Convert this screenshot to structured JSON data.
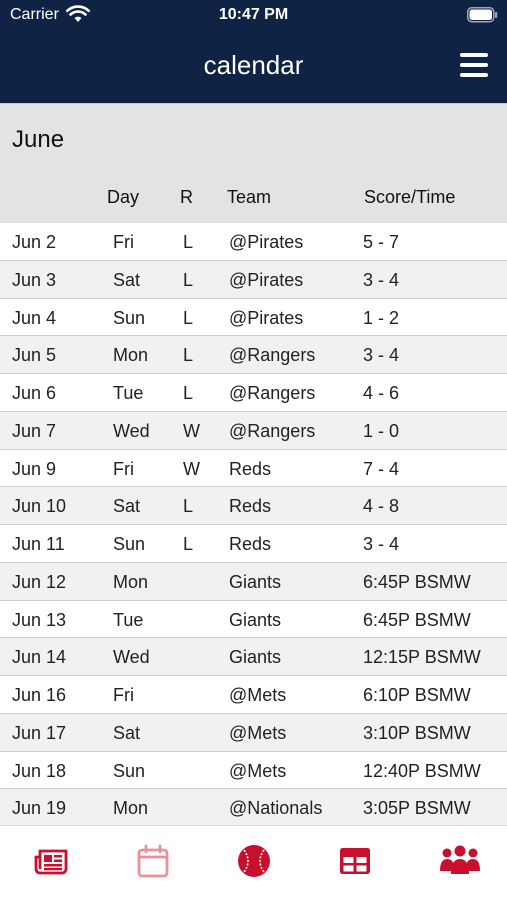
{
  "status": {
    "carrier": "Carrier",
    "time": "10:47 PM"
  },
  "header": {
    "title": "calendar",
    "menu_icon": "hamburger-menu-icon"
  },
  "month": "June",
  "columns": {
    "date": "",
    "day": "Day",
    "result": "R",
    "team": "Team",
    "score": "Score/Time"
  },
  "games": [
    {
      "date": "Jun 2",
      "day": "Fri",
      "result": "L",
      "team": "@Pirates",
      "score": "5 - 7"
    },
    {
      "date": "Jun 3",
      "day": "Sat",
      "result": "L",
      "team": "@Pirates",
      "score": "3 - 4"
    },
    {
      "date": "Jun 4",
      "day": "Sun",
      "result": "L",
      "team": "@Pirates",
      "score": "1 - 2"
    },
    {
      "date": "Jun 5",
      "day": "Mon",
      "result": "L",
      "team": "@Rangers",
      "score": "3 - 4"
    },
    {
      "date": "Jun 6",
      "day": "Tue",
      "result": "L",
      "team": "@Rangers",
      "score": "4 - 6"
    },
    {
      "date": "Jun 7",
      "day": "Wed",
      "result": "W",
      "team": "@Rangers",
      "score": "1 - 0"
    },
    {
      "date": "Jun 9",
      "day": "Fri",
      "result": "W",
      "team": "Reds",
      "score": "7 - 4"
    },
    {
      "date": "Jun 10",
      "day": "Sat",
      "result": "L",
      "team": "Reds",
      "score": "4 - 8"
    },
    {
      "date": "Jun 11",
      "day": "Sun",
      "result": "L",
      "team": "Reds",
      "score": "3 - 4"
    },
    {
      "date": "Jun 12",
      "day": "Mon",
      "result": "",
      "team": "Giants",
      "score": "6:45P BSMW"
    },
    {
      "date": "Jun 13",
      "day": "Tue",
      "result": "",
      "team": "Giants",
      "score": "6:45P BSMW"
    },
    {
      "date": "Jun 14",
      "day": "Wed",
      "result": "",
      "team": "Giants",
      "score": "12:15P BSMW"
    },
    {
      "date": "Jun 16",
      "day": "Fri",
      "result": "",
      "team": "@Mets",
      "score": "6:10P BSMW"
    },
    {
      "date": "Jun 17",
      "day": "Sat",
      "result": "",
      "team": "@Mets",
      "score": "3:10P BSMW"
    },
    {
      "date": "Jun 18",
      "day": "Sun",
      "result": "",
      "team": "@Mets",
      "score": "12:40P BSMW"
    },
    {
      "date": "Jun 19",
      "day": "Mon",
      "result": "",
      "team": "@Nationals",
      "score": "3:05P BSMW"
    }
  ],
  "tabs": [
    {
      "name": "news",
      "icon": "newspaper-icon",
      "active": false
    },
    {
      "name": "calendar",
      "icon": "calendar-icon",
      "active": true
    },
    {
      "name": "scores",
      "icon": "baseball-icon",
      "active": false
    },
    {
      "name": "standings",
      "icon": "table-grid-icon",
      "active": false
    },
    {
      "name": "roster",
      "icon": "team-people-icon",
      "active": false
    }
  ],
  "colors": {
    "header_bg": "#0f2444",
    "section_bg": "#e3e3e3",
    "alt_row_bg": "#f1f1f1",
    "tab_icon": "#c8102e",
    "tab_icon_active": "#eb8f9a"
  }
}
